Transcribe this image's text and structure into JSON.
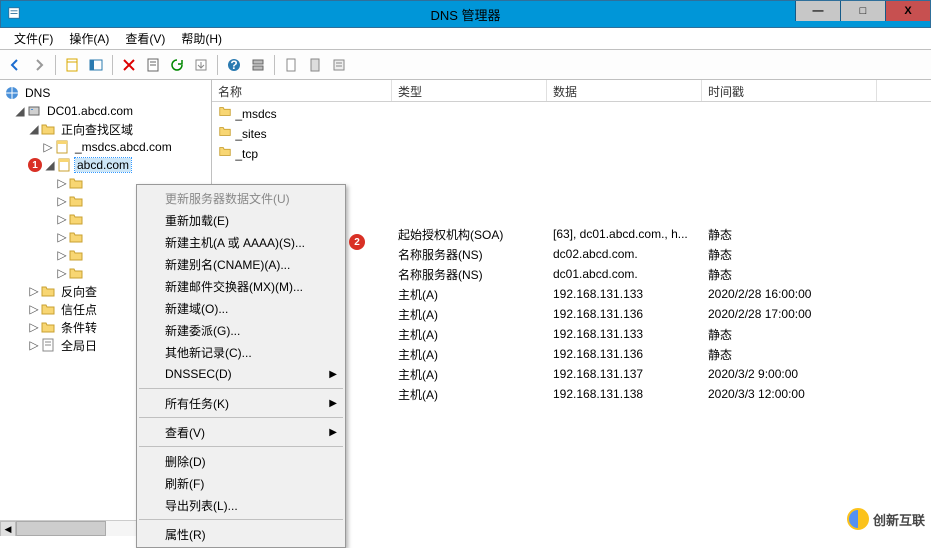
{
  "window": {
    "title": "DNS 管理器",
    "min_label": "—",
    "max_label": "□",
    "close_label": "X"
  },
  "menu": {
    "file": "文件(F)",
    "action": "操作(A)",
    "view": "查看(V)",
    "help": "帮助(H)"
  },
  "tree": {
    "root": "DNS",
    "server": "DC01.abcd.com",
    "fwd_zone": "正向查找区域",
    "zone_msdcs": "_msdcs.abcd.com",
    "zone_abcd": "abcd.com",
    "rev_zone": "反向查",
    "trust": "信任点",
    "cond": "条件转",
    "global": "全局日",
    "badge1": "1"
  },
  "columns": {
    "name": "名称",
    "type": "类型",
    "data": "数据",
    "ts": "时间戳"
  },
  "folders": [
    {
      "name": "_msdcs"
    },
    {
      "name": "_sites"
    },
    {
      "name": "_tcp"
    }
  ],
  "records": [
    {
      "name": "",
      "type": "起始授权机构(SOA)",
      "data": "[63], dc01.abcd.com., h...",
      "ts": "静态"
    },
    {
      "name": "",
      "type": "名称服务器(NS)",
      "data": "dc02.abcd.com.",
      "ts": "静态"
    },
    {
      "name": "",
      "type": "名称服务器(NS)",
      "data": "dc01.abcd.com.",
      "ts": "静态"
    },
    {
      "name": "",
      "type": "主机(A)",
      "data": "192.168.131.133",
      "ts": "2020/2/28 16:00:00"
    },
    {
      "name": "",
      "type": "主机(A)",
      "data": "192.168.131.136",
      "ts": "2020/2/28 17:00:00"
    },
    {
      "name": "",
      "type": "主机(A)",
      "data": "192.168.131.133",
      "ts": "静态"
    },
    {
      "name": "",
      "type": "主机(A)",
      "data": "192.168.131.136",
      "ts": "静态"
    },
    {
      "name": "",
      "type": "主机(A)",
      "data": "192.168.131.137",
      "ts": "2020/3/2 9:00:00"
    },
    {
      "name": "",
      "type": "主机(A)",
      "data": "192.168.131.138",
      "ts": "2020/3/3 12:00:00"
    }
  ],
  "ctx": {
    "update": "更新服务器数据文件(U)",
    "reload": "重新加载(E)",
    "new_host": "新建主机(A 或 AAAA)(S)...",
    "new_alias": "新建别名(CNAME)(A)...",
    "new_mx": "新建邮件交换器(MX)(M)...",
    "new_domain": "新建域(O)...",
    "new_delegation": "新建委派(G)...",
    "other_records": "其他新记录(C)...",
    "dnssec": "DNSSEC(D)",
    "all_tasks": "所有任务(K)",
    "view": "查看(V)",
    "delete": "删除(D)",
    "refresh": "刷新(F)",
    "export": "导出列表(L)...",
    "properties": "属性(R)",
    "badge2": "2"
  },
  "watermark": "创新互联"
}
